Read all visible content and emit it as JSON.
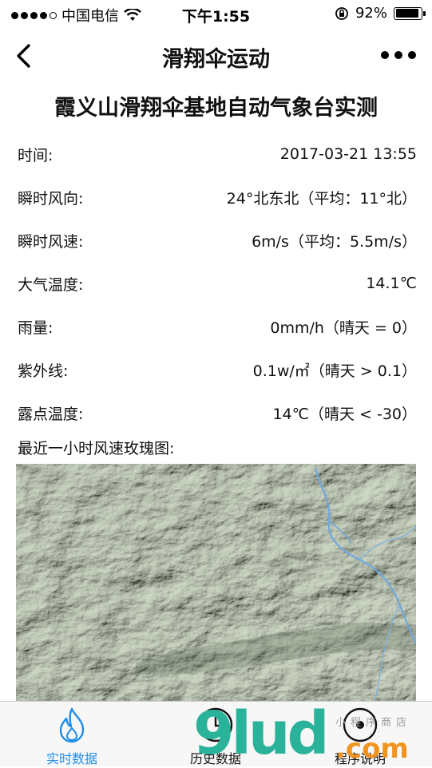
{
  "status": {
    "carrier": "中国电信",
    "time": "下午1:55",
    "battery": "92%"
  },
  "nav": {
    "title": "滑翔伞运动"
  },
  "main_title": "霞义山滑翔伞基地自动气象台实测",
  "rows": [
    {
      "label": "时间:",
      "value": "2017-03-21 13:55"
    },
    {
      "label": "瞬时风向:",
      "value": "24°北东北（平均：11°北）"
    },
    {
      "label": "瞬时风速:",
      "value": "6m/s（平均：5.5m/s）"
    },
    {
      "label": "大气温度:",
      "value": "14.1℃"
    },
    {
      "label": "雨量:",
      "value": "0mm/h（晴天 = 0）"
    },
    {
      "label": "紫外线:",
      "value": "0.1w/㎡（晴天 > 0.1）"
    },
    {
      "label": "露点温度:",
      "value": "14℃（晴天 < -30）"
    }
  ],
  "rose_label": "最近一小时风速玫瑰图:",
  "tabs": [
    {
      "label": "实时数据",
      "icon": "flame-icon",
      "active": true
    },
    {
      "label": "历史数据",
      "icon": "clock-icon",
      "active": false
    },
    {
      "label": "程序说明",
      "icon": "info-icon",
      "active": false
    }
  ],
  "watermark": {
    "main": "9lud",
    "suffix": ".com",
    "small": "小程序商店"
  },
  "colors": {
    "accent": "#1f8ee8",
    "terrain": "#c9d2c0",
    "river": "#6fa8dc"
  }
}
